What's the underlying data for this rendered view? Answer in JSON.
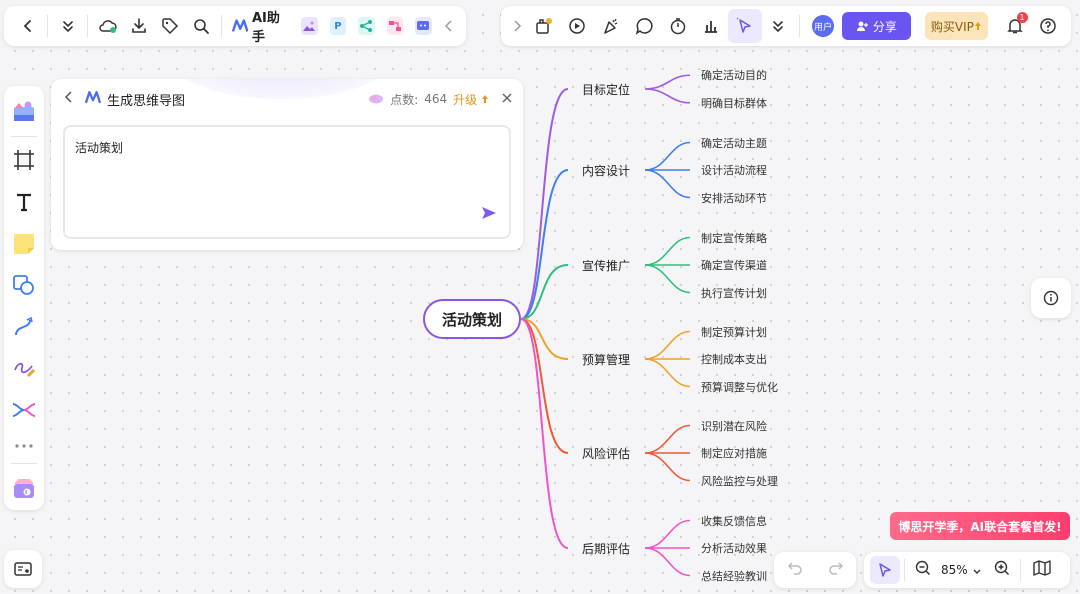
{
  "toolbar_left": {
    "ai_label": "AI助手",
    "mini_p": "P"
  },
  "toolbar_right": {
    "avatar_text": "用户",
    "share_label": "分享",
    "vip_label": "购买VIP",
    "notification_count": "1"
  },
  "ai_panel": {
    "title": "生成思维导图",
    "points_label": "点数:",
    "points_value": "464",
    "upgrade_label": "升级",
    "input_value": "活动策划"
  },
  "mindmap": {
    "root": "活动策划",
    "branches": [
      {
        "label": "目标定位",
        "color": "#a05be6",
        "children": [
          "确定活动目的",
          "明确目标群体"
        ]
      },
      {
        "label": "内容设计",
        "color": "#3f7ef0",
        "children": [
          "确定活动主题",
          "设计活动流程",
          "安排活动环节"
        ]
      },
      {
        "label": "宣传推广",
        "color": "#2fc07a",
        "children": [
          "制定宣传策略",
          "确定宣传渠道",
          "执行宣传计划"
        ]
      },
      {
        "label": "预算管理",
        "color": "#f1a02a",
        "children": [
          "制定预算计划",
          "控制成本支出",
          "预算调整与优化"
        ]
      },
      {
        "label": "风险评估",
        "color": "#f05a3a",
        "children": [
          "识别潜在风险",
          "制定应对措施",
          "风险监控与处理"
        ]
      },
      {
        "label": "后期评估",
        "color": "#ee55c8",
        "children": [
          "收集反馈信息",
          "分析活动效果",
          "总结经验教训"
        ]
      }
    ]
  },
  "promo_text": "博思开学季，AI联合套餐首发!",
  "zoom": {
    "value": "85%"
  },
  "colors": {
    "accent": "#6a55f0",
    "root_border": "#8a56e2"
  }
}
